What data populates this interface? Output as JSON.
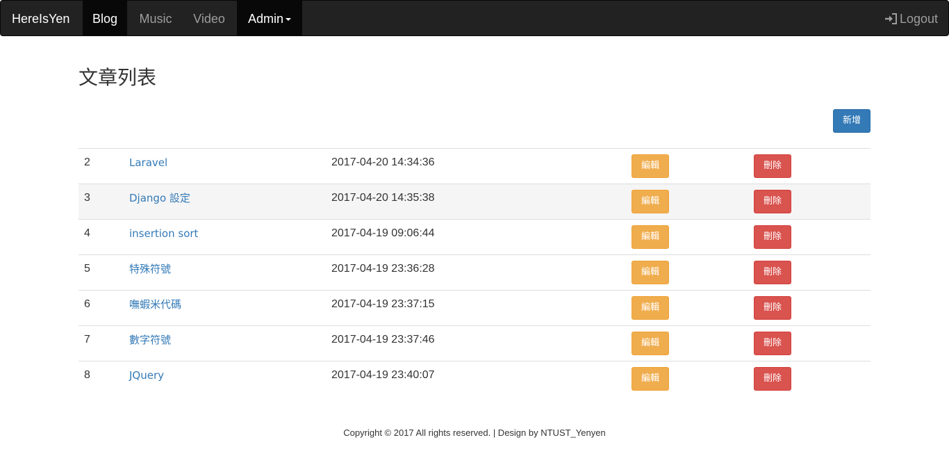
{
  "navbar": {
    "brand": "HereIsYen",
    "links": [
      {
        "label": "Blog"
      },
      {
        "label": "Music"
      },
      {
        "label": "Video"
      },
      {
        "label": "Admin"
      }
    ],
    "logout_label": "Logout"
  },
  "page": {
    "title": "文章列表",
    "new_button": "新增"
  },
  "table": {
    "edit_label": "編輯",
    "delete_label": "刪除",
    "rows": [
      {
        "id": "2",
        "title": "Laravel",
        "date": "2017-04-20 14:34:36"
      },
      {
        "id": "3",
        "title": "Django 設定",
        "date": "2017-04-20 14:35:38"
      },
      {
        "id": "4",
        "title": "insertion sort",
        "date": "2017-04-19 09:06:44"
      },
      {
        "id": "5",
        "title": "特殊符號",
        "date": "2017-04-19 23:36:28"
      },
      {
        "id": "6",
        "title": "嘸蝦米代碼",
        "date": "2017-04-19 23:37:15"
      },
      {
        "id": "7",
        "title": "數字符號",
        "date": "2017-04-19 23:37:46"
      },
      {
        "id": "8",
        "title": "JQuery",
        "date": "2017-04-19 23:40:07"
      }
    ]
  },
  "footer": {
    "text": "Copyright © 2017 All rights reserved. | Design by NTUST_Yenyen"
  },
  "colors": {
    "navbar_bg": "#222222",
    "primary": "#337ab7",
    "warning": "#f0ad4e",
    "danger": "#d9534f"
  },
  "icons": {
    "logout": "log-in-icon"
  }
}
